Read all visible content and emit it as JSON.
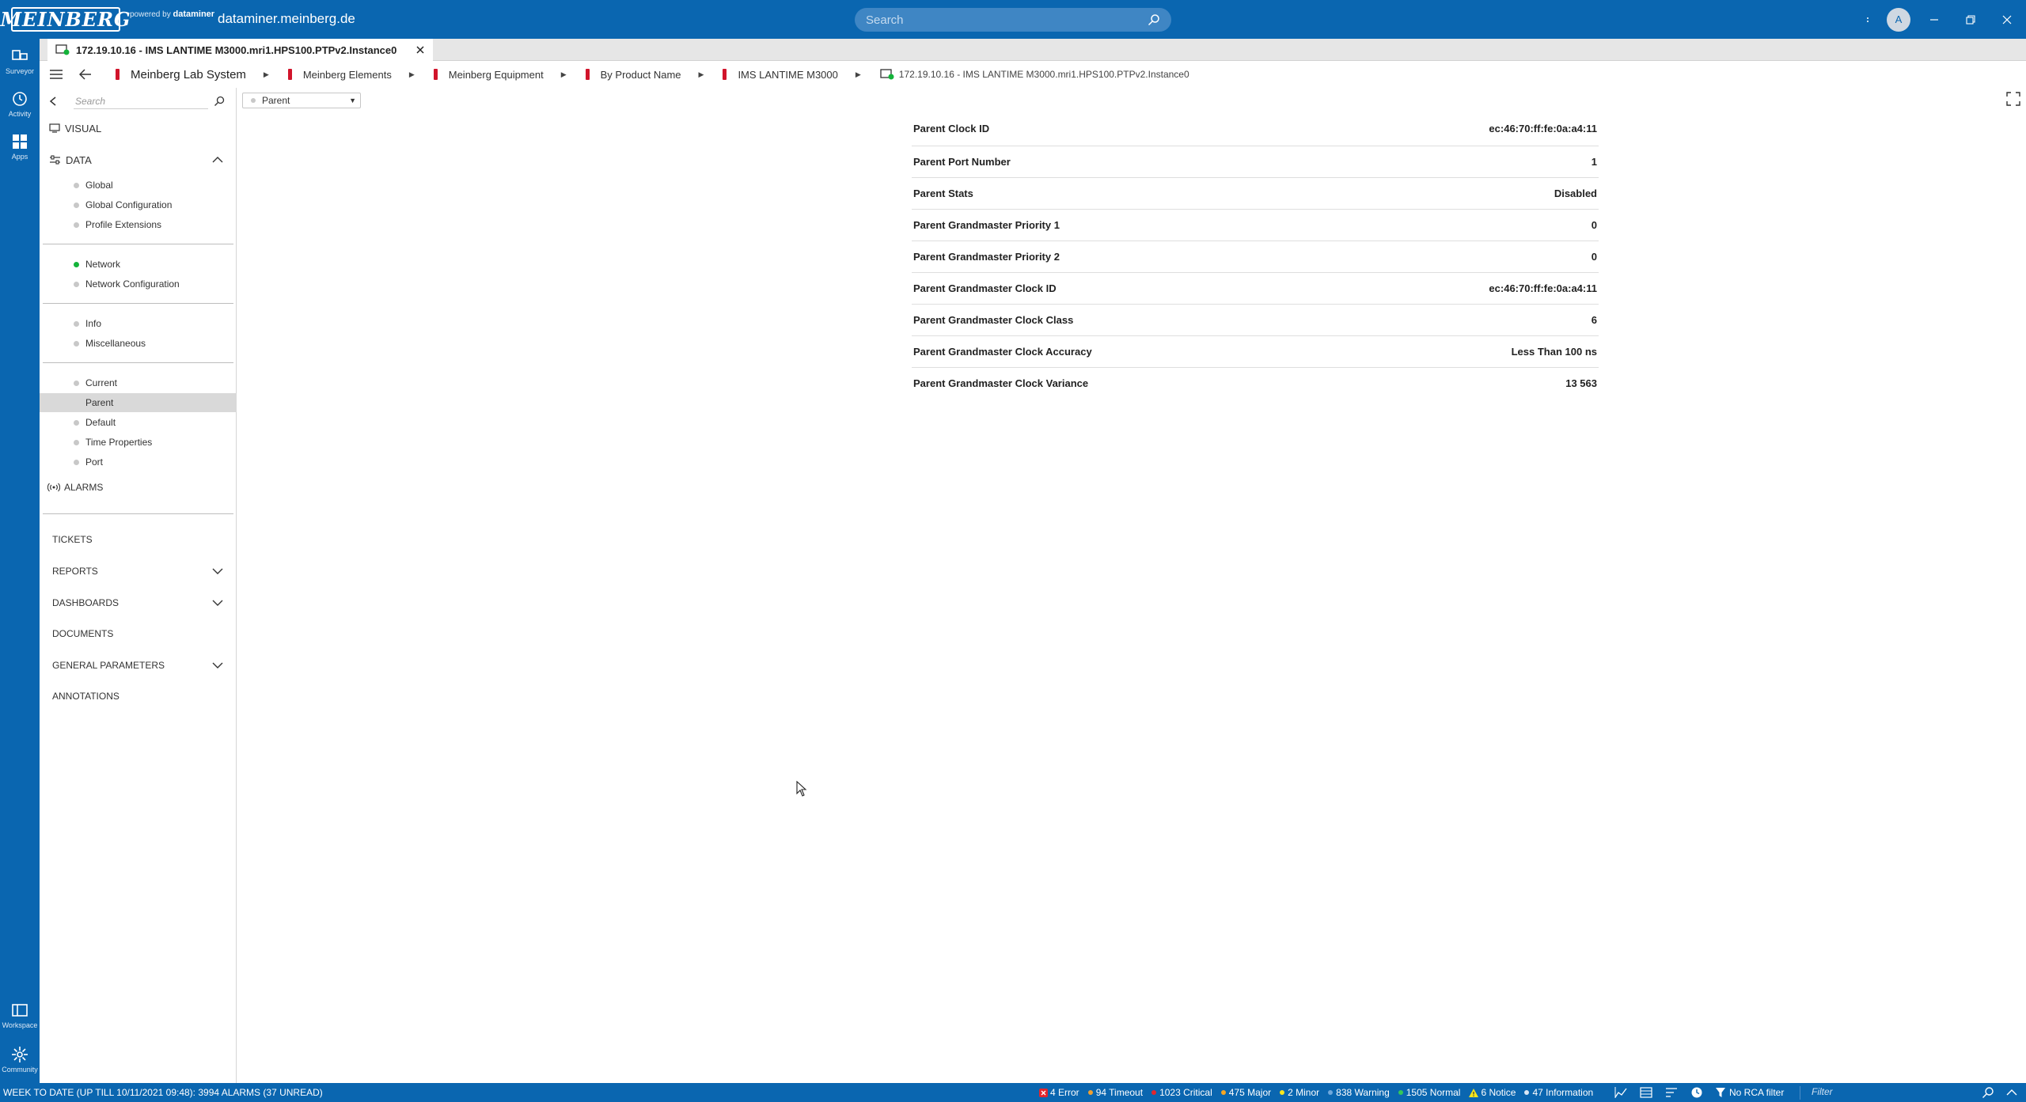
{
  "topbar": {
    "logo_text": "MEINBERG",
    "powered_by": "powered by",
    "powered_brand": "dataminer",
    "host": "dataminer.meinberg.de",
    "search_placeholder": "Search",
    "avatar_letter": "A"
  },
  "rail": {
    "items": [
      {
        "label": "Surveyor",
        "icon": "surveyor-icon"
      },
      {
        "label": "Activity",
        "icon": "clock-icon"
      },
      {
        "label": "Apps",
        "icon": "apps-grid-icon"
      }
    ],
    "bottom_items": [
      {
        "label": "Workspace",
        "icon": "workspace-icon"
      },
      {
        "label": "Community",
        "icon": "community-icon"
      }
    ]
  },
  "tab": {
    "title": "172.19.10.16 - IMS LANTIME M3000.mri1.HPS100.PTPv2.Instance0"
  },
  "breadcrumb": {
    "items": [
      "Meinberg Lab System",
      "Meinberg Elements",
      "Meinberg Equipment",
      "By Product Name",
      "IMS LANTIME M3000",
      "172.19.10.16 - IMS LANTIME M3000.mri1.HPS100.PTPv2.Instance0"
    ]
  },
  "sidebar": {
    "search_placeholder": "Search",
    "visual": "VISUAL",
    "data": "DATA",
    "groups": [
      [
        "Global",
        "Global Configuration",
        "Profile Extensions"
      ],
      [
        "Network",
        "Network Configuration"
      ],
      [
        "Info",
        "Miscellaneous"
      ],
      [
        "Current",
        "Parent",
        "Default",
        "Time Properties",
        "Port"
      ]
    ],
    "selected": "Parent",
    "alarms": "ALARMS",
    "tickets": "TICKETS",
    "reports": "REPORTS",
    "dashboards": "DASHBOARDS",
    "documents": "DOCUMENTS",
    "general_parameters": "GENERAL PARAMETERS",
    "annotations": "ANNOTATIONS"
  },
  "main": {
    "page_selector": "Parent",
    "parameters": [
      {
        "label": "Parent Clock ID",
        "value": "ec:46:70:ff:fe:0a:a4:11"
      },
      {
        "label": "Parent Port Number",
        "value": "1"
      },
      {
        "label": "Parent Stats",
        "value": "Disabled"
      },
      {
        "label": "Parent Grandmaster Priority 1",
        "value": "0"
      },
      {
        "label": "Parent Grandmaster Priority 2",
        "value": "0"
      },
      {
        "label": "Parent Grandmaster Clock ID",
        "value": "ec:46:70:ff:fe:0a:a4:11"
      },
      {
        "label": "Parent Grandmaster Clock Class",
        "value": "6"
      },
      {
        "label": "Parent Grandmaster Clock Accuracy",
        "value": "Less Than 100 ns"
      },
      {
        "label": "Parent Grandmaster Clock Variance",
        "value": "13 563"
      }
    ]
  },
  "statusbar": {
    "summary": "WEEK TO DATE (UP TILL 10/11/2021 09:48): 3994 ALARMS (37 UNREAD)",
    "counts": [
      {
        "label": "4 Error",
        "color": "#e3262d",
        "kind": "error"
      },
      {
        "label": "94 Timeout",
        "color": "#f0a030",
        "kind": "dot"
      },
      {
        "label": "1023 Critical",
        "color": "#e3262d",
        "kind": "dot"
      },
      {
        "label": "475 Major",
        "color": "#f5a623",
        "kind": "dot"
      },
      {
        "label": "2 Minor",
        "color": "#f8e71c",
        "kind": "dot"
      },
      {
        "label": "838 Warning",
        "color": "#6fa8dc",
        "kind": "dot"
      },
      {
        "label": "1505 Normal",
        "color": "#34c759",
        "kind": "dot"
      },
      {
        "label": "6 Notice",
        "color": "#f8e71c",
        "kind": "notice"
      },
      {
        "label": "47 Information",
        "color": "#d9e7f5",
        "kind": "dot"
      }
    ],
    "rca_filter": "No RCA filter",
    "filter_placeholder": "Filter"
  },
  "colors": {
    "brand_blue": "#0a66b0",
    "flag_red": "#d1142b",
    "network_green": "#14b33a"
  }
}
